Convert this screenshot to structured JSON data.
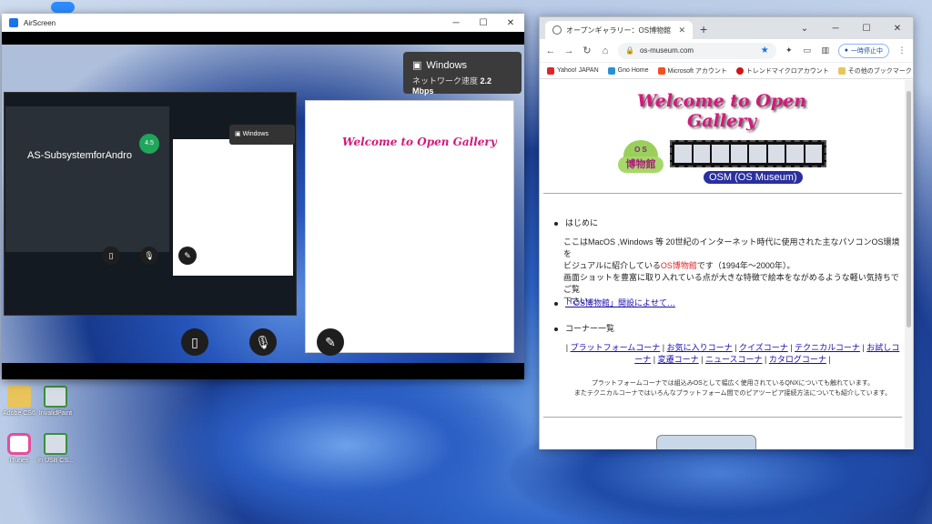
{
  "desktop": {
    "top_icon_label": "zoom",
    "icons": [
      {
        "label": "Adobe CS6",
        "color": "#e9c45a"
      },
      {
        "label": "InvalidPaint",
        "color": "#3a8f3a"
      },
      {
        "label": "iTunes",
        "color": "#e54d9c"
      },
      {
        "label": "In USB CS...",
        "color": "#3a8f3a"
      }
    ]
  },
  "airscreen": {
    "title": "AirScreen",
    "toast": {
      "title": "Windows",
      "speed_label": "ネットワーク速度",
      "speed_value": "2.2 Mbps"
    },
    "inner_toast": "Windows",
    "inner_app_title": "AS-SubsystemforAndro",
    "inner_app_value": "4.5",
    "controls": [
      "screen",
      "mic",
      "draw"
    ]
  },
  "browser": {
    "tab_title": "オープンギャラリー：OS博物館",
    "url": "os-museum.com",
    "pause_label": "一時停止中",
    "bookmarks": [
      {
        "label": "Yahoo! JAPAN",
        "color": "#e0242a"
      },
      {
        "label": "Gno Home",
        "color": "#2a8fd8"
      },
      {
        "label": "Microsoft アカウント",
        "color": "#f25022"
      },
      {
        "label": "トレンドマイクロアカウント",
        "color": "#d0141a"
      }
    ],
    "bookmarks_right": "その他のブックマーク",
    "page": {
      "heading": "Welcome to Open Gallery",
      "badge_text_top": "O S",
      "badge_text_bottom": "博物館",
      "osm_label": "OSM (OS Museum)",
      "intro_heading": "はじめに",
      "intro_line1": "ここはMacOS ,Windows 等 20世紀のインターネット時代に使用された主なパソコンOS環境を",
      "intro_line2_pre": "ビジュアルに紹介している",
      "intro_line2_red": "OS博物館",
      "intro_line2_post": "です（1994年〜2000年）。",
      "intro_line3": "画面ショットを豊富に取り入れている点が大きな特徴で絵本をながめるような軽い気持ちでご覧",
      "intro_line4": "下さい。",
      "open_link": "「OS博物館」開設によせて…",
      "corner_heading": "コーナー一覧",
      "corners": [
        "プラットフォームコーナ",
        "お気に入りコーナ",
        "クイズコーナ",
        "テクニカルコーナ",
        "お試しコーナ",
        "変遷コーナ",
        "ニュースコーナ",
        "カタログコーナ"
      ],
      "note1": "プラットフォームコーナでは組込みOSとして幅広く使用されているQNXについても触れています。",
      "note2": "またテクニカルコーナではいろんなプラットフォーム間でのピアツーピア接続方法についても紹介しています。"
    }
  }
}
